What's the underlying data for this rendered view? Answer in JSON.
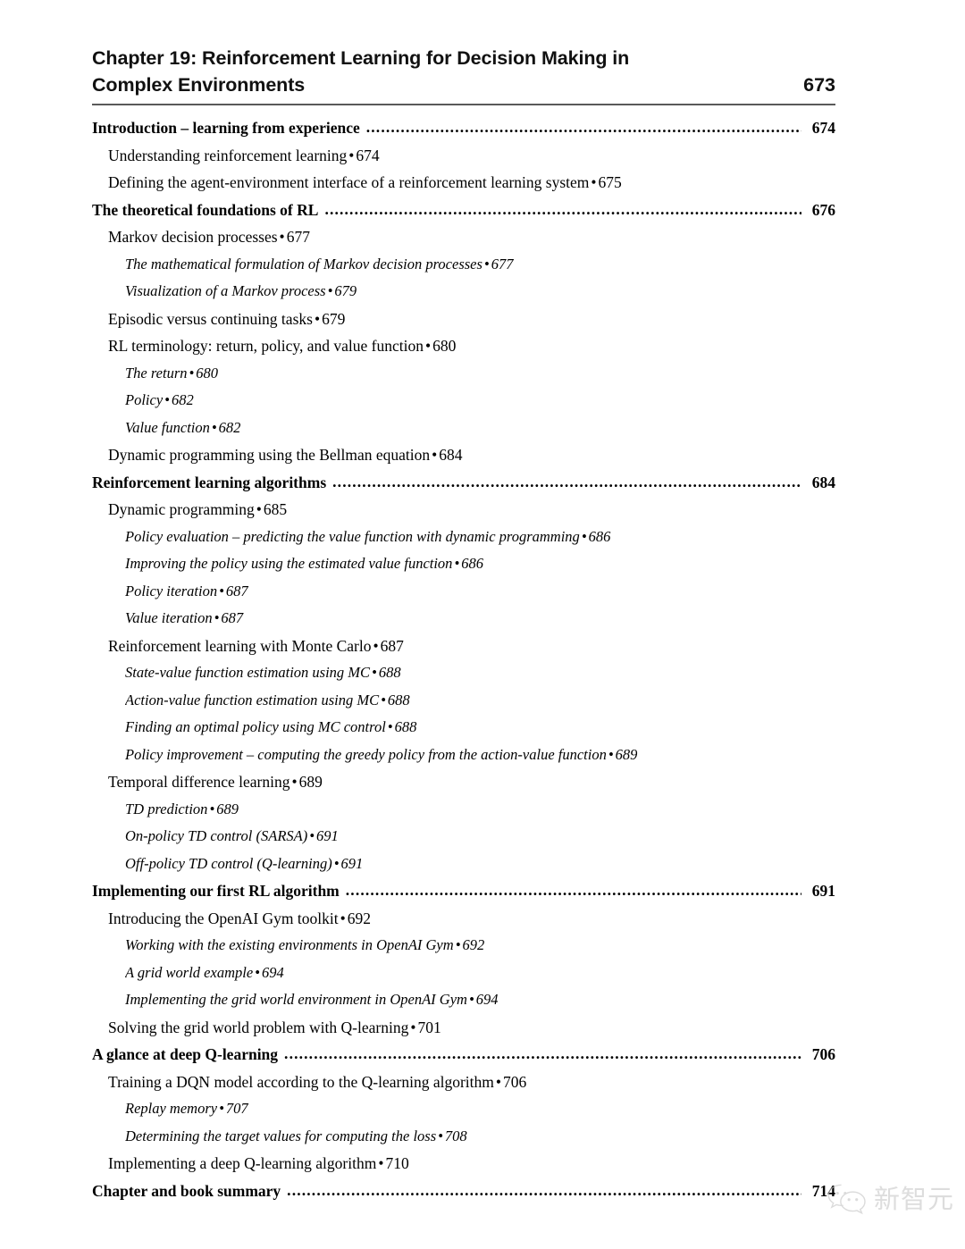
{
  "header": {
    "title_line1": "Chapter 19: Reinforcement Learning for Decision Making in",
    "title_line2": "Complex Environments",
    "page": "673"
  },
  "toc": {
    "entries": [
      {
        "level": 1,
        "title": "Introduction – learning from experience",
        "page": "674"
      },
      {
        "level": 2,
        "title": "Understanding reinforcement learning",
        "page": "674"
      },
      {
        "level": 2,
        "title": "Defining the agent-environment interface of a reinforcement learning system",
        "page": "675"
      },
      {
        "level": 1,
        "title": "The theoretical foundations of RL",
        "page": "676"
      },
      {
        "level": 2,
        "title": "Markov decision processes",
        "page": "677"
      },
      {
        "level": 3,
        "title": "The mathematical formulation of Markov decision processes",
        "page": "677"
      },
      {
        "level": 3,
        "title": "Visualization of a Markov process",
        "page": "679"
      },
      {
        "level": 2,
        "title": "Episodic versus continuing tasks",
        "page": "679"
      },
      {
        "level": 2,
        "title": "RL terminology: return, policy, and value function",
        "page": "680"
      },
      {
        "level": 3,
        "title": "The return",
        "page": "680"
      },
      {
        "level": 3,
        "title": "Policy",
        "page": "682"
      },
      {
        "level": 3,
        "title": "Value function",
        "page": "682"
      },
      {
        "level": 2,
        "title": "Dynamic programming using the Bellman equation",
        "page": "684"
      },
      {
        "level": 1,
        "title": "Reinforcement learning algorithms",
        "page": "684"
      },
      {
        "level": 2,
        "title": "Dynamic programming",
        "page": "685"
      },
      {
        "level": 3,
        "title": "Policy evaluation – predicting the value function with dynamic programming",
        "page": "686"
      },
      {
        "level": 3,
        "title": "Improving the policy using the estimated value function",
        "page": "686"
      },
      {
        "level": 3,
        "title": "Policy iteration",
        "page": "687"
      },
      {
        "level": 3,
        "title": "Value iteration",
        "page": "687"
      },
      {
        "level": 2,
        "title": "Reinforcement learning with Monte Carlo",
        "page": "687"
      },
      {
        "level": 3,
        "title": "State-value function estimation using MC",
        "page": "688"
      },
      {
        "level": 3,
        "title": "Action-value function estimation using MC",
        "page": "688"
      },
      {
        "level": 3,
        "title": "Finding an optimal policy using MC control",
        "page": "688"
      },
      {
        "level": 3,
        "title": "Policy improvement – computing the greedy policy from the action-value function",
        "page": "689"
      },
      {
        "level": 2,
        "title": "Temporal difference learning",
        "page": "689"
      },
      {
        "level": 3,
        "title": "TD prediction",
        "page": "689"
      },
      {
        "level": 3,
        "title": "On-policy TD control (SARSA)",
        "page": "691"
      },
      {
        "level": 3,
        "title": "Off-policy TD control (Q-learning)",
        "page": "691"
      },
      {
        "level": 1,
        "title": "Implementing our first RL algorithm",
        "page": "691"
      },
      {
        "level": 2,
        "title": "Introducing the OpenAI Gym toolkit",
        "page": "692"
      },
      {
        "level": 3,
        "title": "Working with the existing environments in OpenAI Gym",
        "page": "692"
      },
      {
        "level": 3,
        "title": "A grid world example",
        "page": "694"
      },
      {
        "level": 3,
        "title": "Implementing the grid world environment in OpenAI Gym",
        "page": "694"
      },
      {
        "level": 2,
        "title": "Solving the grid world problem with Q-learning",
        "page": "701"
      },
      {
        "level": 1,
        "title": "A glance at deep Q-learning",
        "page": "706"
      },
      {
        "level": 2,
        "title": "Training a DQN model according to the Q-learning algorithm",
        "page": "706"
      },
      {
        "level": 3,
        "title": "Replay memory",
        "page": "707"
      },
      {
        "level": 3,
        "title": "Determining the target values for computing the loss",
        "page": "708"
      },
      {
        "level": 2,
        "title": "Implementing a deep Q-learning algorithm",
        "page": "710"
      },
      {
        "level": 1,
        "title": "Chapter and book summary",
        "page": "714"
      }
    ],
    "separator": "•",
    "leader_dot": "."
  },
  "watermark": {
    "text": "新智元",
    "icon": "wechat-icon",
    "color": "#c9c9c9"
  },
  "colors": {
    "text": "#000000",
    "rule": "#5a5a5a",
    "background": "#ffffff"
  }
}
